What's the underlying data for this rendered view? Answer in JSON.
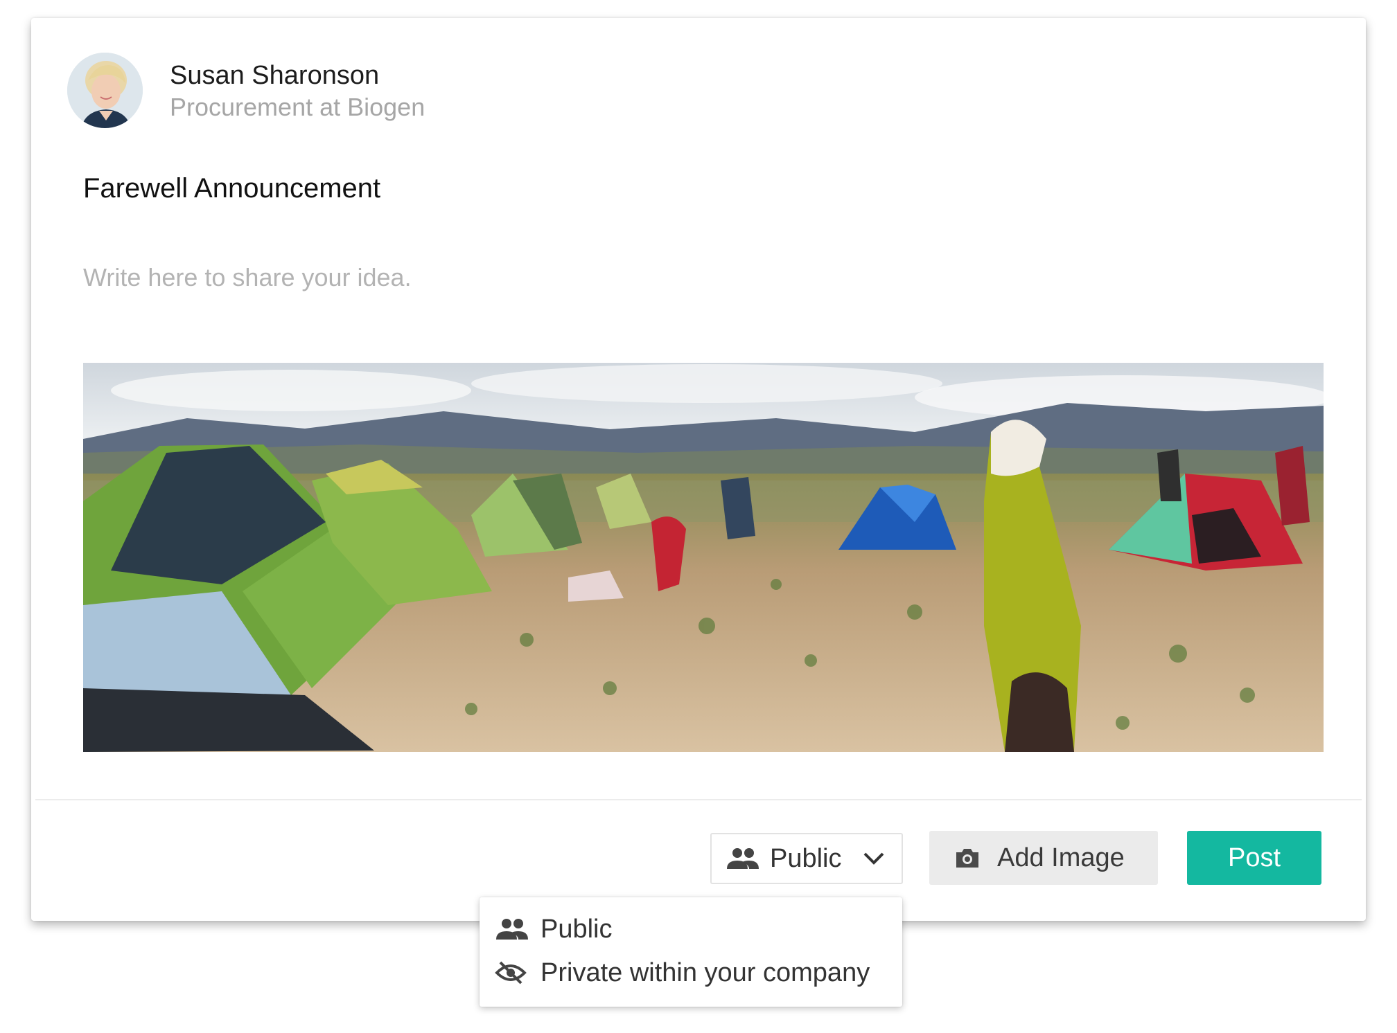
{
  "author": {
    "name": "Susan Sharonson",
    "title": "Procurement at Biogen",
    "avatar_icon": "user-avatar"
  },
  "post": {
    "title": "Farewell Announcement",
    "body_placeholder": "Write here to share your idea.",
    "image_icon": "post-photo-tent-camp"
  },
  "toolbar": {
    "visibility_label": "Public",
    "visibility_icon": "people-icon",
    "add_image_label": "Add Image",
    "add_image_icon": "camera-icon",
    "post_label": "Post"
  },
  "visibility_menu": {
    "items": [
      {
        "label": "Public",
        "icon": "people-icon"
      },
      {
        "label": "Private within your company",
        "icon": "eye-off-icon"
      }
    ]
  },
  "colors": {
    "accent": "#14b8a0",
    "muted_text": "#a6a6a6",
    "button_bg": "#ebebeb"
  }
}
